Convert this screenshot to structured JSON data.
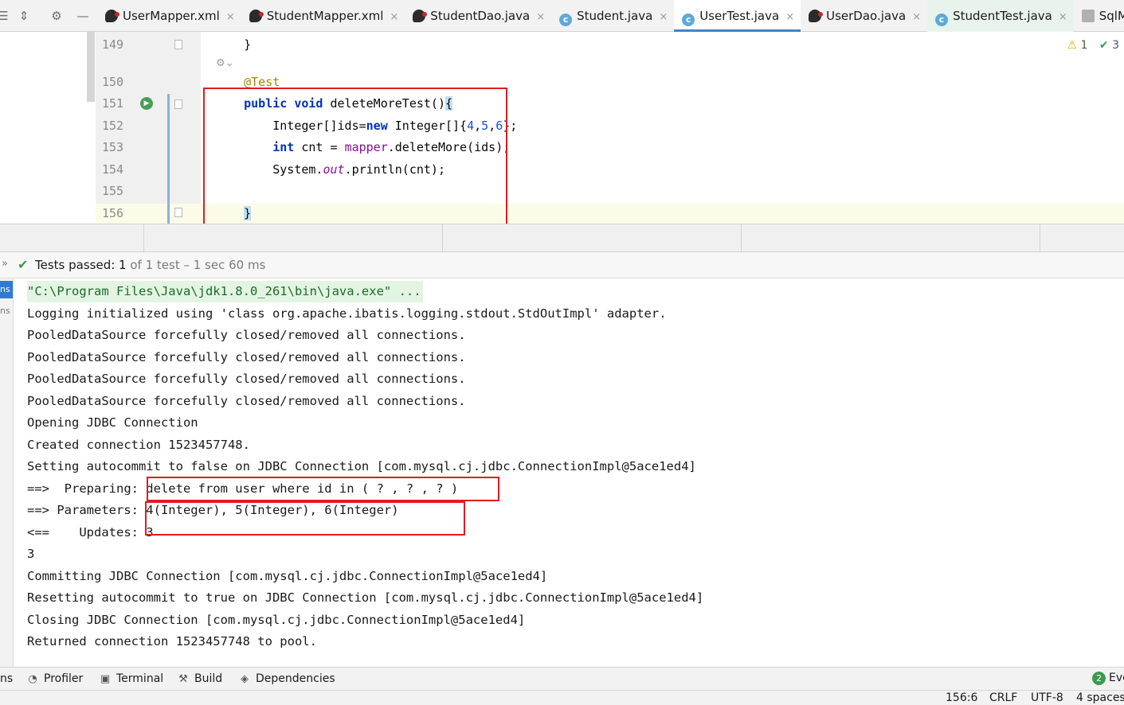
{
  "tabs": [
    {
      "label": "UserMapper.xml",
      "icon": "mybatis-xml-icon"
    },
    {
      "label": "StudentMapper.xml",
      "icon": "mybatis-xml-icon"
    },
    {
      "label": "StudentDao.java",
      "icon": "mybatis-java-icon"
    },
    {
      "label": "Student.java",
      "icon": "java-class-icon"
    },
    {
      "label": "UserTest.java",
      "icon": "java-class-icon",
      "active": true
    },
    {
      "label": "UserDao.java",
      "icon": "mybatis-java-icon"
    },
    {
      "label": "StudentTest.java",
      "icon": "java-class-icon"
    },
    {
      "label": "SqlM",
      "icon": "sql-file-icon"
    }
  ],
  "close_glyph": "×",
  "editor": {
    "inspections": {
      "warnings": "1",
      "ok": "3"
    },
    "inlay_hint": "⚙⌄",
    "lines": [
      {
        "num": "149",
        "text": "    }"
      },
      {
        "num": "150",
        "text": "    @Test"
      },
      {
        "num": "151",
        "text": "    public void deleteMoreTest(){"
      },
      {
        "num": "152",
        "text": "        Integer[]ids=new Integer[]{4,5,6};"
      },
      {
        "num": "153",
        "text": "        int cnt = mapper.deleteMore(ids);"
      },
      {
        "num": "154",
        "text": "        System.out.println(cnt);"
      },
      {
        "num": "155",
        "text": ""
      },
      {
        "num": "156",
        "text": "    }"
      }
    ]
  },
  "run": {
    "status_bold": "Tests passed: 1",
    "status_rest": " of 1 test – 1 sec 60 ms",
    "side_tabs": [
      "ns",
      "ns"
    ],
    "console": [
      "\"C:\\Program Files\\Java\\jdk1.8.0_261\\bin\\java.exe\" ...",
      "Logging initialized using 'class org.apache.ibatis.logging.stdout.StdOutImpl' adapter.",
      "PooledDataSource forcefully closed/removed all connections.",
      "PooledDataSource forcefully closed/removed all connections.",
      "PooledDataSource forcefully closed/removed all connections.",
      "PooledDataSource forcefully closed/removed all connections.",
      "Opening JDBC Connection",
      "Created connection 1523457748.",
      "Setting autocommit to false on JDBC Connection [com.mysql.cj.jdbc.ConnectionImpl@5ace1ed4]",
      "==>  Preparing: delete from user where id in ( ? , ? , ? )",
      "==> Parameters: 4(Integer), 5(Integer), 6(Integer)",
      "<==    Updates: 3",
      "3",
      "Committing JDBC Connection [com.mysql.cj.jdbc.ConnectionImpl@5ace1ed4]",
      "Resetting autocommit to true on JDBC Connection [com.mysql.cj.jdbc.ConnectionImpl@5ace1ed4]",
      "Closing JDBC Connection [com.mysql.cj.jdbc.ConnectionImpl@5ace1ed4]",
      "Returned connection 1523457748 to pool."
    ]
  },
  "tool_windows": {
    "left_stub": "ns",
    "profiler": "Profiler",
    "terminal": "Terminal",
    "build": "Build",
    "dependencies": "Dependencies",
    "event_log": "Eve",
    "event_count": "2"
  },
  "statusbar": {
    "position": "156:6",
    "line_sep": "CRLF",
    "encoding": "UTF-8",
    "indent": "4 spaces"
  },
  "colors": {
    "accent": "#4083c9",
    "keyword": "#0033b3",
    "highlight_box": "#e01b24",
    "success": "#3c9a4e"
  }
}
